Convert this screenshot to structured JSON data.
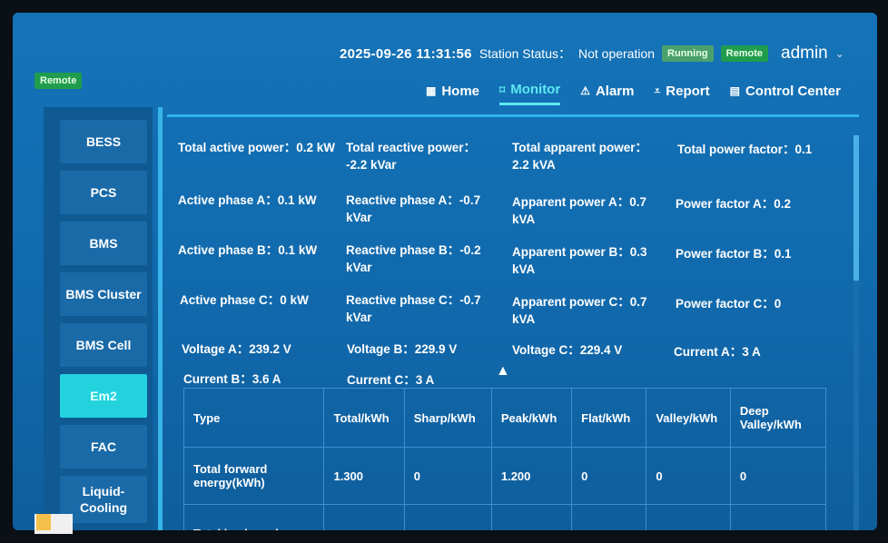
{
  "header": {
    "datetime": "2025-09-26 11:31:56",
    "station_status_label": "Station Status：",
    "station_status_value": "Not operation",
    "running_badge": "Running",
    "remote_badge": "Remote",
    "user": "admin",
    "left_remote": "Remote"
  },
  "nav": [
    {
      "icon": "▦",
      "label": "Home"
    },
    {
      "icon": "⌑",
      "label": "Monitor"
    },
    {
      "icon": "⚠",
      "label": "Alarm"
    },
    {
      "icon": "⩡",
      "label": "Report"
    },
    {
      "icon": "▤",
      "label": "Control Center"
    }
  ],
  "sidebar": [
    {
      "label": "BESS"
    },
    {
      "label": "PCS"
    },
    {
      "label": "BMS"
    },
    {
      "label": "BMS Cluster"
    },
    {
      "label": "BMS Cell"
    },
    {
      "label": "Em2"
    },
    {
      "label": "FAC"
    },
    {
      "label": "Liquid-Cooling"
    }
  ],
  "metrics": [
    {
      "label": "Total active power：",
      "value": "0.2 kW"
    },
    {
      "label": "Total reactive power：",
      "value": "-2.2 kVar"
    },
    {
      "label": "Total apparent power：",
      "value": "2.2 kVA"
    },
    {
      "label": "Total power factor：",
      "value": "0.1"
    },
    {
      "label": "Active phase A：",
      "value": "0.1 kW"
    },
    {
      "label": "Reactive phase A：",
      "value": "-0.7 kVar"
    },
    {
      "label": "Apparent power A：",
      "value": "0.7 kVA"
    },
    {
      "label": "Power factor A：",
      "value": "0.2"
    },
    {
      "label": "Active phase B：",
      "value": "0.1 kW"
    },
    {
      "label": "Reactive phase B：",
      "value": "-0.2 kVar"
    },
    {
      "label": "Apparent power B：",
      "value": "0.3 kVA"
    },
    {
      "label": "Power factor B：",
      "value": "0.1"
    },
    {
      "label": "Active phase C：",
      "value": "0 kW"
    },
    {
      "label": "Reactive phase C：",
      "value": "-0.7 kVar"
    },
    {
      "label": "Apparent power C：",
      "value": "0.7 kVA"
    },
    {
      "label": "Power factor C：",
      "value": "0"
    },
    {
      "label": "Voltage A：",
      "value": "239.2 V"
    },
    {
      "label": "Voltage B：",
      "value": "229.9 V"
    },
    {
      "label": "Voltage C：",
      "value": "229.4 V"
    },
    {
      "label": "Current A：",
      "value": "3 A"
    },
    {
      "label": "Current B：",
      "value": "3.6 A"
    },
    {
      "label": "Current C：",
      "value": "3 A"
    }
  ],
  "table": {
    "headers": [
      "Type",
      "Total/kWh",
      "Sharp/kWh",
      "Peak/kWh",
      "Flat/kWh",
      "Valley/kWh",
      "Deep Valley/kWh"
    ],
    "rows": [
      [
        "Total forward energy(kWh)",
        "1.300",
        "0",
        "1.200",
        "0",
        "0",
        "0"
      ],
      [
        "Total backward",
        "",
        "",
        "",
        "",
        "",
        ""
      ]
    ]
  }
}
